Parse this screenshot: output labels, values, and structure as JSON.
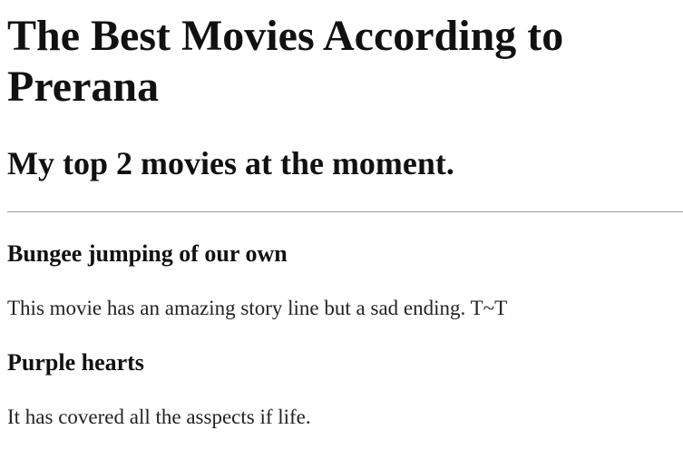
{
  "page": {
    "title": "The Best Movies According to Prerana",
    "subtitle": "My top 2 movies at the moment."
  },
  "movies": [
    {
      "title": "Bungee jumping of our own",
      "description": "This movie has an amazing story line but a sad ending. T~T"
    },
    {
      "title": "Purple hearts",
      "description": "It has covered all the asspects if life."
    }
  ]
}
